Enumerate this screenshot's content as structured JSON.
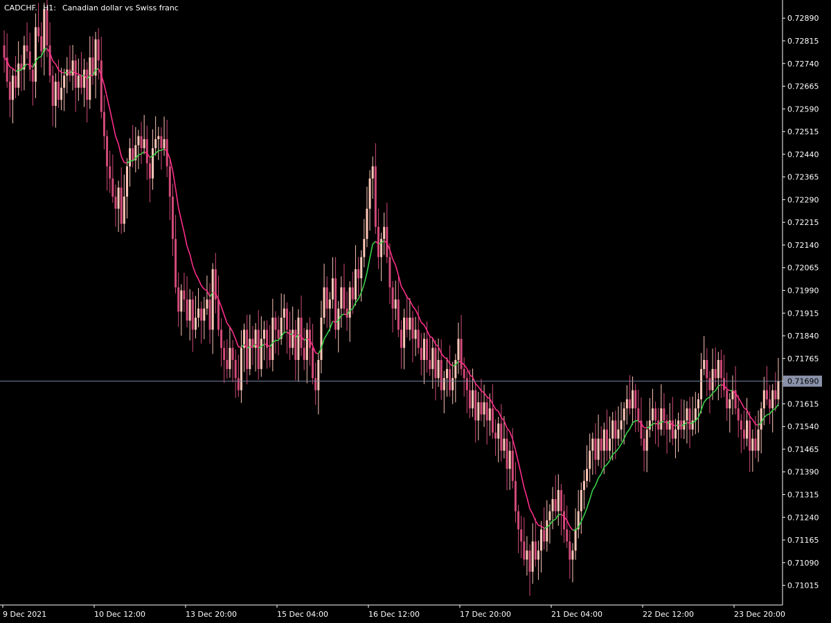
{
  "header": {
    "symbol": "CADCHF.",
    "timeframe": "H1:",
    "description": "Canadian dollar vs Swiss franc"
  },
  "colors": {
    "background": "#000000",
    "candle_up": "#ffc7b8",
    "candle_down": "#d14a78",
    "ma_up": "#39d24a",
    "ma_down": "#ff2e8a",
    "axis": "#ffffff",
    "price_line": "#7a86a6",
    "price_tag": "#8a93aa"
  },
  "chart_data": {
    "type": "candlestick",
    "symbol": "CADCHF.",
    "timeframe": "H1",
    "y_range": [
      0.7095,
      0.7295
    ],
    "y_ticks": [
      "0.72890",
      "0.72815",
      "0.72740",
      "0.72665",
      "0.72590",
      "0.72515",
      "0.72440",
      "0.72365",
      "0.72290",
      "0.72215",
      "0.72140",
      "0.72065",
      "0.71990",
      "0.71915",
      "0.71840",
      "0.71765",
      "0.71690",
      "0.71615",
      "0.71540",
      "0.71465",
      "0.71390",
      "0.71315",
      "0.71240",
      "0.71165",
      "0.71090",
      "0.71015"
    ],
    "x_labels": [
      {
        "label": "9 Dec 2021",
        "at": 0
      },
      {
        "label": "10 Dec 12:00",
        "at": 32
      },
      {
        "label": "13 Dec 20:00",
        "at": 64
      },
      {
        "label": "15 Dec 04:00",
        "at": 96
      },
      {
        "label": "16 Dec 12:00",
        "at": 128
      },
      {
        "label": "17 Dec 20:00",
        "at": 160
      },
      {
        "label": "21 Dec 04:00",
        "at": 192
      },
      {
        "label": "22 Dec 12:00",
        "at": 224
      },
      {
        "label": "23 Dec 20:00",
        "at": 256
      }
    ],
    "current_price": "0.71690",
    "series_close": [
      0.7276,
      0.7268,
      0.7262,
      0.727,
      0.7266,
      0.7274,
      0.7272,
      0.728,
      0.7278,
      0.7272,
      0.7268,
      0.7286,
      0.7283,
      0.7278,
      0.7292,
      0.728,
      0.727,
      0.726,
      0.7268,
      0.7262,
      0.7266,
      0.727,
      0.7272,
      0.727,
      0.7275,
      0.7266,
      0.727,
      0.7266,
      0.7272,
      0.7262,
      0.7276,
      0.727,
      0.7282,
      0.7275,
      0.7258,
      0.725,
      0.724,
      0.7236,
      0.723,
      0.7226,
      0.7233,
      0.7221,
      0.723,
      0.724,
      0.7246,
      0.7242,
      0.7247,
      0.725,
      0.7246,
      0.7249,
      0.7241,
      0.7236,
      0.7246,
      0.7249,
      0.725,
      0.7246,
      0.7249,
      0.724,
      0.723,
      0.7216,
      0.72,
      0.7192,
      0.7199,
      0.7196,
      0.7189,
      0.7196,
      0.7186,
      0.719,
      0.7193,
      0.7189,
      0.7193,
      0.7196,
      0.7186,
      0.7206,
      0.7196,
      0.7186,
      0.718,
      0.7176,
      0.7173,
      0.718,
      0.7176,
      0.717,
      0.7166,
      0.718,
      0.7186,
      0.7173,
      0.7183,
      0.718,
      0.7186,
      0.7173,
      0.7183,
      0.7186,
      0.718,
      0.7176,
      0.719,
      0.7186,
      0.7183,
      0.719,
      0.7193,
      0.7186,
      0.718,
      0.7186,
      0.7176,
      0.719,
      0.718,
      0.7176,
      0.7186,
      0.718,
      0.717,
      0.7166,
      0.7176,
      0.719,
      0.72,
      0.7193,
      0.7196,
      0.7203,
      0.7186,
      0.7193,
      0.72,
      0.7193,
      0.719,
      0.72,
      0.7196,
      0.7206,
      0.7203,
      0.721,
      0.7216,
      0.7226,
      0.7236,
      0.724,
      0.722,
      0.721,
      0.7216,
      0.722,
      0.721,
      0.72,
      0.7193,
      0.7196,
      0.7186,
      0.718,
      0.719,
      0.7186,
      0.719,
      0.7183,
      0.7186,
      0.718,
      0.7176,
      0.7183,
      0.7176,
      0.7173,
      0.718,
      0.717,
      0.7176,
      0.7166,
      0.717,
      0.7173,
      0.7166,
      0.717,
      0.7176,
      0.7183,
      0.7173,
      0.717,
      0.7166,
      0.716,
      0.7166,
      0.7156,
      0.7162,
      0.7158,
      0.7162,
      0.7156,
      0.716,
      0.7152,
      0.715,
      0.7155,
      0.7146,
      0.715,
      0.714,
      0.7146,
      0.7136,
      0.7126,
      0.712,
      0.7116,
      0.711,
      0.7113,
      0.7106,
      0.7116,
      0.711,
      0.7113,
      0.712,
      0.7116,
      0.7123,
      0.7126,
      0.713,
      0.7126,
      0.7133,
      0.7126,
      0.712,
      0.7116,
      0.711,
      0.7113,
      0.712,
      0.7126,
      0.7133,
      0.7136,
      0.714,
      0.7146,
      0.715,
      0.7143,
      0.715,
      0.7146,
      0.7153,
      0.7146,
      0.715,
      0.7156,
      0.715,
      0.7153,
      0.7156,
      0.716,
      0.7163,
      0.716,
      0.7166,
      0.716,
      0.7156,
      0.715,
      0.7146,
      0.7153,
      0.7156,
      0.716,
      0.7156,
      0.7153,
      0.716,
      0.7156,
      0.7153,
      0.7156,
      0.715,
      0.7153,
      0.7156,
      0.7153,
      0.7156,
      0.716,
      0.7153,
      0.7156,
      0.716,
      0.7163,
      0.7173,
      0.7176,
      0.717,
      0.7166,
      0.7173,
      0.717,
      0.7176,
      0.717,
      0.7166,
      0.716,
      0.7163,
      0.7166,
      0.716,
      0.7156,
      0.7153,
      0.715,
      0.7156,
      0.7146,
      0.715,
      0.7146,
      0.7153,
      0.716,
      0.7166,
      0.7163,
      0.716,
      0.7166,
      0.7163,
      0.7169
    ]
  }
}
